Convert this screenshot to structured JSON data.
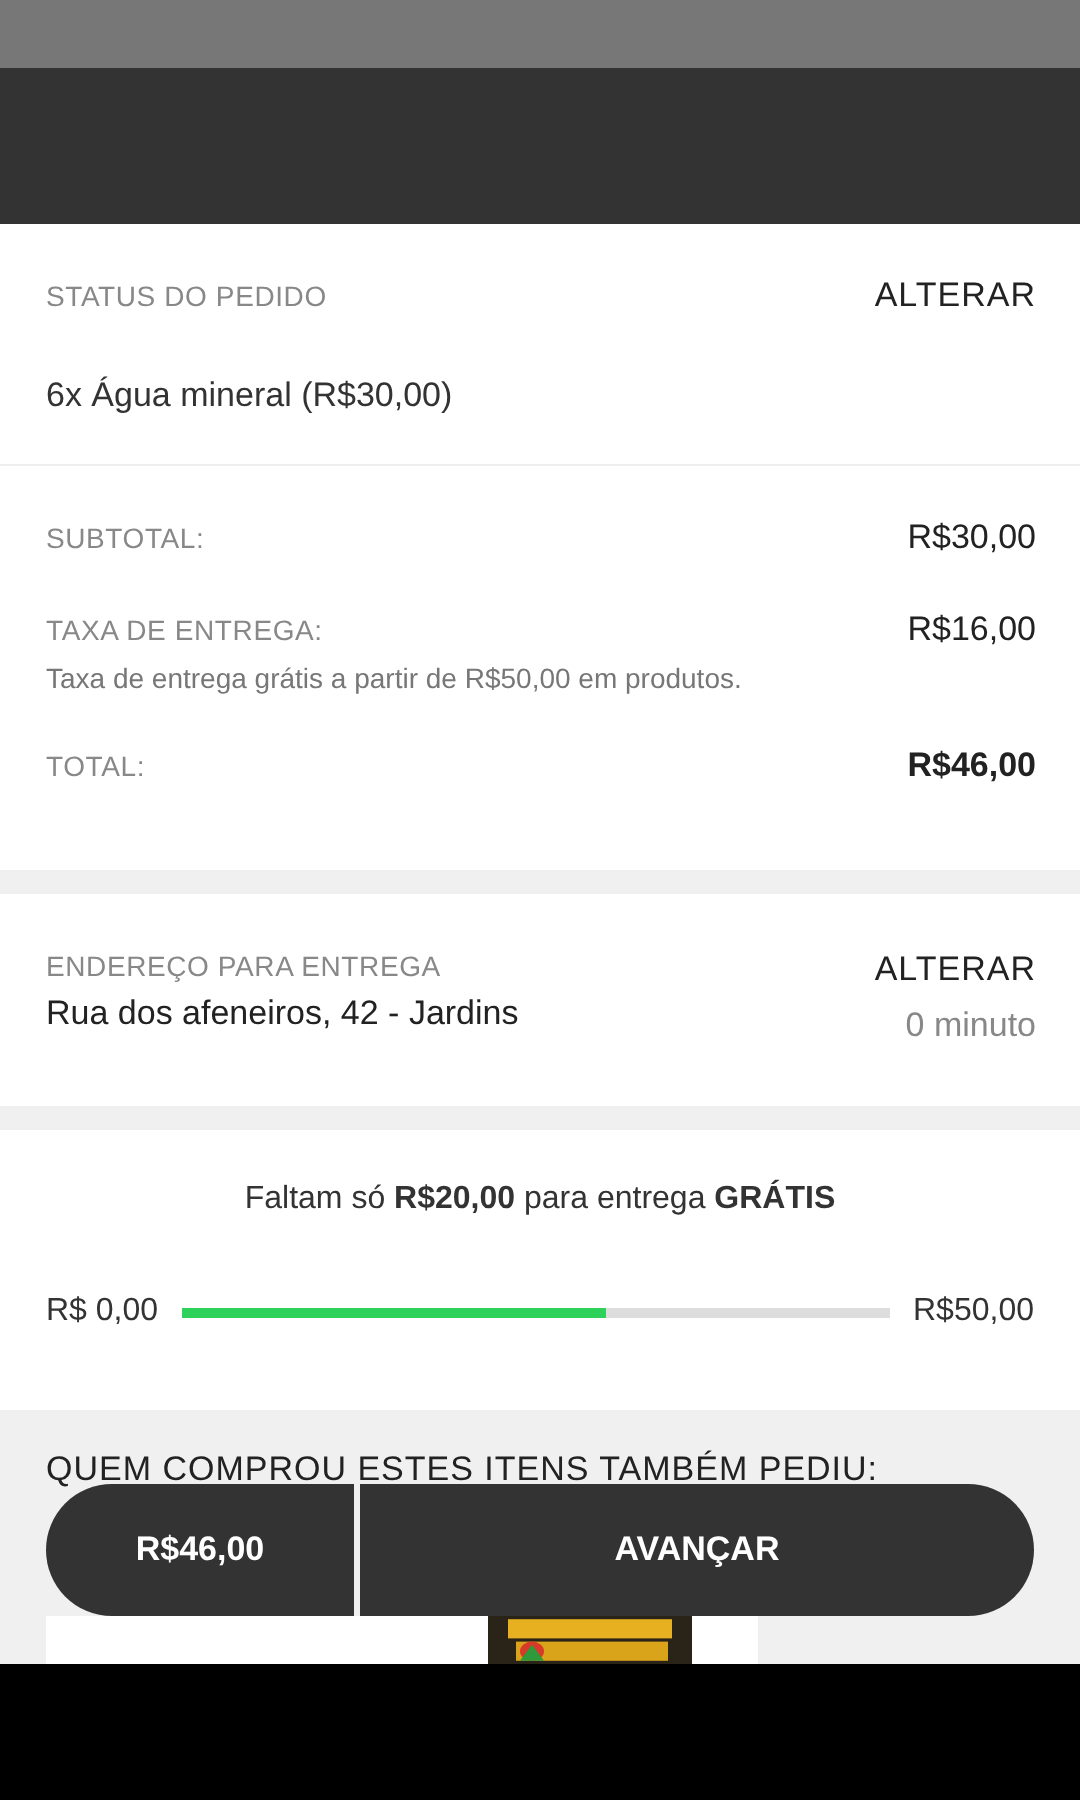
{
  "order": {
    "label": "STATUS DO PEDIDO",
    "action": "ALTERAR",
    "items": [
      "6x Água mineral (R$30,00)"
    ]
  },
  "summary": [
    {
      "label": "SUBTOTAL:",
      "value": "R$30,00",
      "bold": false
    },
    {
      "label": "TAXA DE ENTREGA:",
      "value": "R$16,00",
      "note": "Taxa de entrega grátis a partir de R$50,00 em produtos.",
      "bold": false
    },
    {
      "label": "TOTAL:",
      "value": "R$46,00",
      "bold": true
    }
  ],
  "address": {
    "label": "ENDEREÇO PARA ENTREGA",
    "text": "Rua dos afeneiros, 42 - Jardins",
    "action": "ALTERAR",
    "time": "0 minuto"
  },
  "free_shipping": {
    "message": "Faltam só **R$20,00** para entrega **GRÁTIS**",
    "min": "R$ 0,00",
    "max": "R$50,00",
    "level": 0.6
  },
  "suggestions": {
    "title": "QUEM COMPROU ESTES ITENS TAMBÉM PEDIU:"
  },
  "checkout": {
    "total": "R$46,00",
    "action": "AVANÇAR"
  }
}
